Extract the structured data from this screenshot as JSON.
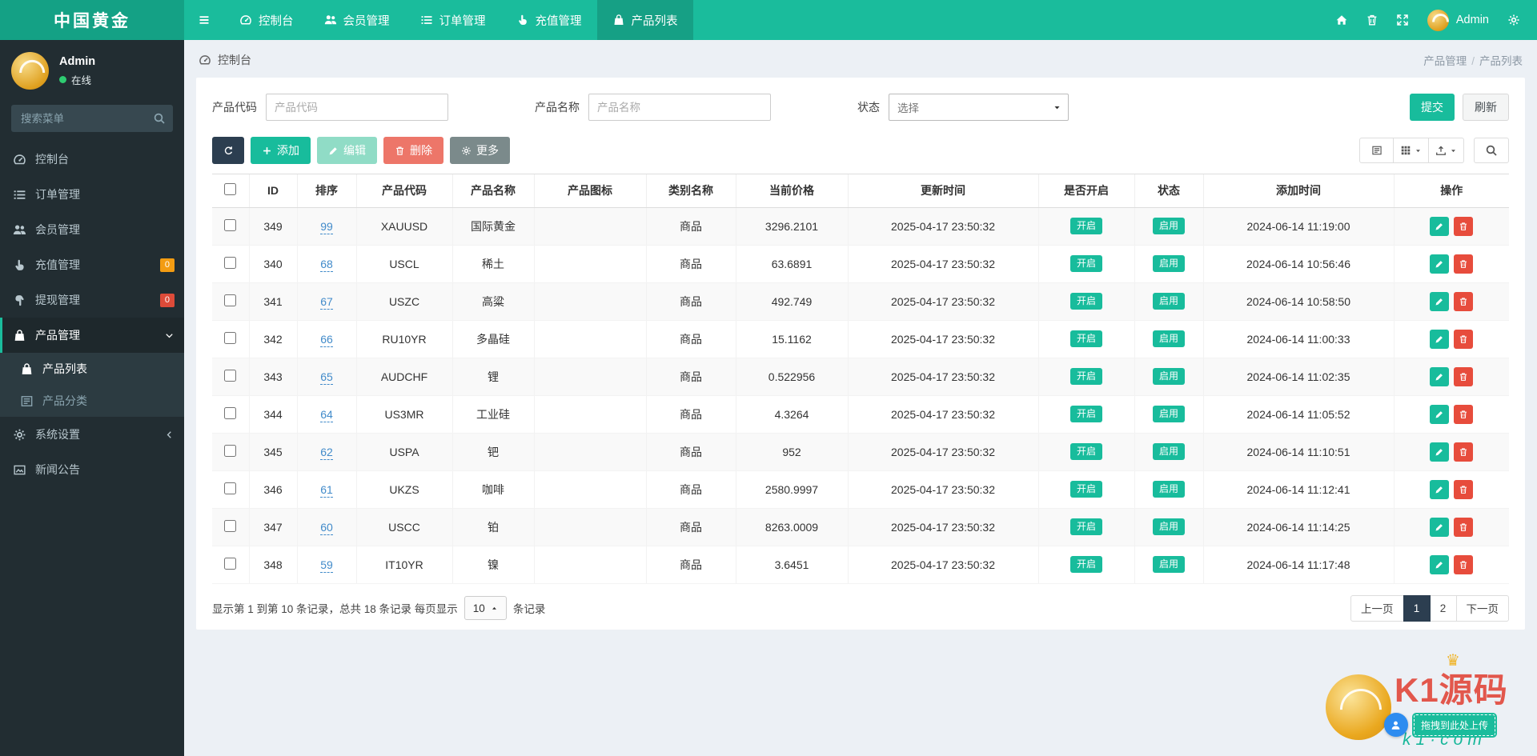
{
  "brand": "中国黄金",
  "topnav": {
    "items": [
      {
        "label": "控制台",
        "icon": "dashboard",
        "active": false
      },
      {
        "label": "会员管理",
        "icon": "users",
        "active": false
      },
      {
        "label": "订单管理",
        "icon": "list",
        "active": false
      },
      {
        "label": "充值管理",
        "icon": "hand",
        "active": false
      },
      {
        "label": "产品列表",
        "icon": "bag",
        "active": true
      }
    ],
    "user_name": "Admin"
  },
  "sidebar": {
    "user": {
      "name": "Admin",
      "status": "在线"
    },
    "search_placeholder": "搜索菜单",
    "menu": [
      {
        "label": "控制台",
        "icon": "dashboard"
      },
      {
        "label": "订单管理",
        "icon": "list"
      },
      {
        "label": "会员管理",
        "icon": "users"
      },
      {
        "label": "充值管理",
        "icon": "hand",
        "badge": "0",
        "badge_color": "#f39c12"
      },
      {
        "label": "提现管理",
        "icon": "hand-down",
        "badge": "0",
        "badge_color": "#dd4b39"
      },
      {
        "label": "产品管理",
        "icon": "bag",
        "active": true,
        "chevron": "down",
        "children": [
          {
            "label": "产品列表",
            "icon": "bag",
            "active": true
          },
          {
            "label": "产品分类",
            "icon": "list-detail",
            "active": false
          }
        ]
      },
      {
        "label": "系统设置",
        "icon": "gear",
        "chevron": "left"
      },
      {
        "label": "新闻公告",
        "icon": "news"
      }
    ]
  },
  "breadcrumb": {
    "section": "控制台",
    "trail": [
      "产品管理",
      "产品列表"
    ]
  },
  "filters": {
    "fields": [
      {
        "label": "产品代码",
        "placeholder": "产品代码"
      },
      {
        "label": "产品名称",
        "placeholder": "产品名称"
      },
      {
        "label": "状态",
        "value": "选择"
      }
    ],
    "submit": "提交",
    "refresh": "刷新"
  },
  "toolbar": {
    "add": "添加",
    "edit": "编辑",
    "delete": "删除",
    "more": "更多"
  },
  "table": {
    "columns": [
      "ID",
      "排序",
      "产品代码",
      "产品名称",
      "产品图标",
      "类别名称",
      "当前价格",
      "更新时间",
      "是否开启",
      "状态",
      "添加时间",
      "操作"
    ],
    "rows": [
      {
        "id": "349",
        "sort": "99",
        "code": "XAUUSD",
        "name": "国际黄金",
        "icon": "",
        "category": "商品",
        "price": "3296.2101",
        "updated": "2025-04-17 23:50:32",
        "enabled": "开启",
        "status": "启用",
        "added": "2024-06-14 11:19:00"
      },
      {
        "id": "340",
        "sort": "68",
        "code": "USCL",
        "name": "稀土",
        "icon": "",
        "category": "商品",
        "price": "63.6891",
        "updated": "2025-04-17 23:50:32",
        "enabled": "开启",
        "status": "启用",
        "added": "2024-06-14 10:56:46"
      },
      {
        "id": "341",
        "sort": "67",
        "code": "USZC",
        "name": "高粱",
        "icon": "",
        "category": "商品",
        "price": "492.749",
        "updated": "2025-04-17 23:50:32",
        "enabled": "开启",
        "status": "启用",
        "added": "2024-06-14 10:58:50"
      },
      {
        "id": "342",
        "sort": "66",
        "code": "RU10YR",
        "name": "多晶硅",
        "icon": "",
        "category": "商品",
        "price": "15.1162",
        "updated": "2025-04-17 23:50:32",
        "enabled": "开启",
        "status": "启用",
        "added": "2024-06-14 11:00:33"
      },
      {
        "id": "343",
        "sort": "65",
        "code": "AUDCHF",
        "name": "锂",
        "icon": "",
        "category": "商品",
        "price": "0.522956",
        "updated": "2025-04-17 23:50:32",
        "enabled": "开启",
        "status": "启用",
        "added": "2024-06-14 11:02:35"
      },
      {
        "id": "344",
        "sort": "64",
        "code": "US3MR",
        "name": "工业硅",
        "icon": "",
        "category": "商品",
        "price": "4.3264",
        "updated": "2025-04-17 23:50:32",
        "enabled": "开启",
        "status": "启用",
        "added": "2024-06-14 11:05:52"
      },
      {
        "id": "345",
        "sort": "62",
        "code": "USPA",
        "name": "钯",
        "icon": "",
        "category": "商品",
        "price": "952",
        "updated": "2025-04-17 23:50:32",
        "enabled": "开启",
        "status": "启用",
        "added": "2024-06-14 11:10:51"
      },
      {
        "id": "346",
        "sort": "61",
        "code": "UKZS",
        "name": "咖啡",
        "icon": "",
        "category": "商品",
        "price": "2580.9997",
        "updated": "2025-04-17 23:50:32",
        "enabled": "开启",
        "status": "启用",
        "added": "2024-06-14 11:12:41"
      },
      {
        "id": "347",
        "sort": "60",
        "code": "USCC",
        "name": "铂",
        "icon": "",
        "category": "商品",
        "price": "8263.0009",
        "updated": "2025-04-17 23:50:32",
        "enabled": "开启",
        "status": "启用",
        "added": "2024-06-14 11:14:25"
      },
      {
        "id": "348",
        "sort": "59",
        "code": "IT10YR",
        "name": "镍",
        "icon": "",
        "category": "商品",
        "price": "3.6451",
        "updated": "2025-04-17 23:50:32",
        "enabled": "开启",
        "status": "启用",
        "added": "2024-06-14 11:17:48"
      }
    ]
  },
  "pagination": {
    "summary_prefix": "显示第 1 到第 10 条记录，总共 18 条记录 每页显示",
    "page_size": "10",
    "summary_suffix": "条记录",
    "prev": "上一页",
    "pages": [
      "1",
      "2"
    ],
    "active": "1",
    "next": "下一页"
  },
  "watermark": {
    "title": "K1源码",
    "sub": "k1·com",
    "upload_tag": "拖拽到此处上传"
  }
}
